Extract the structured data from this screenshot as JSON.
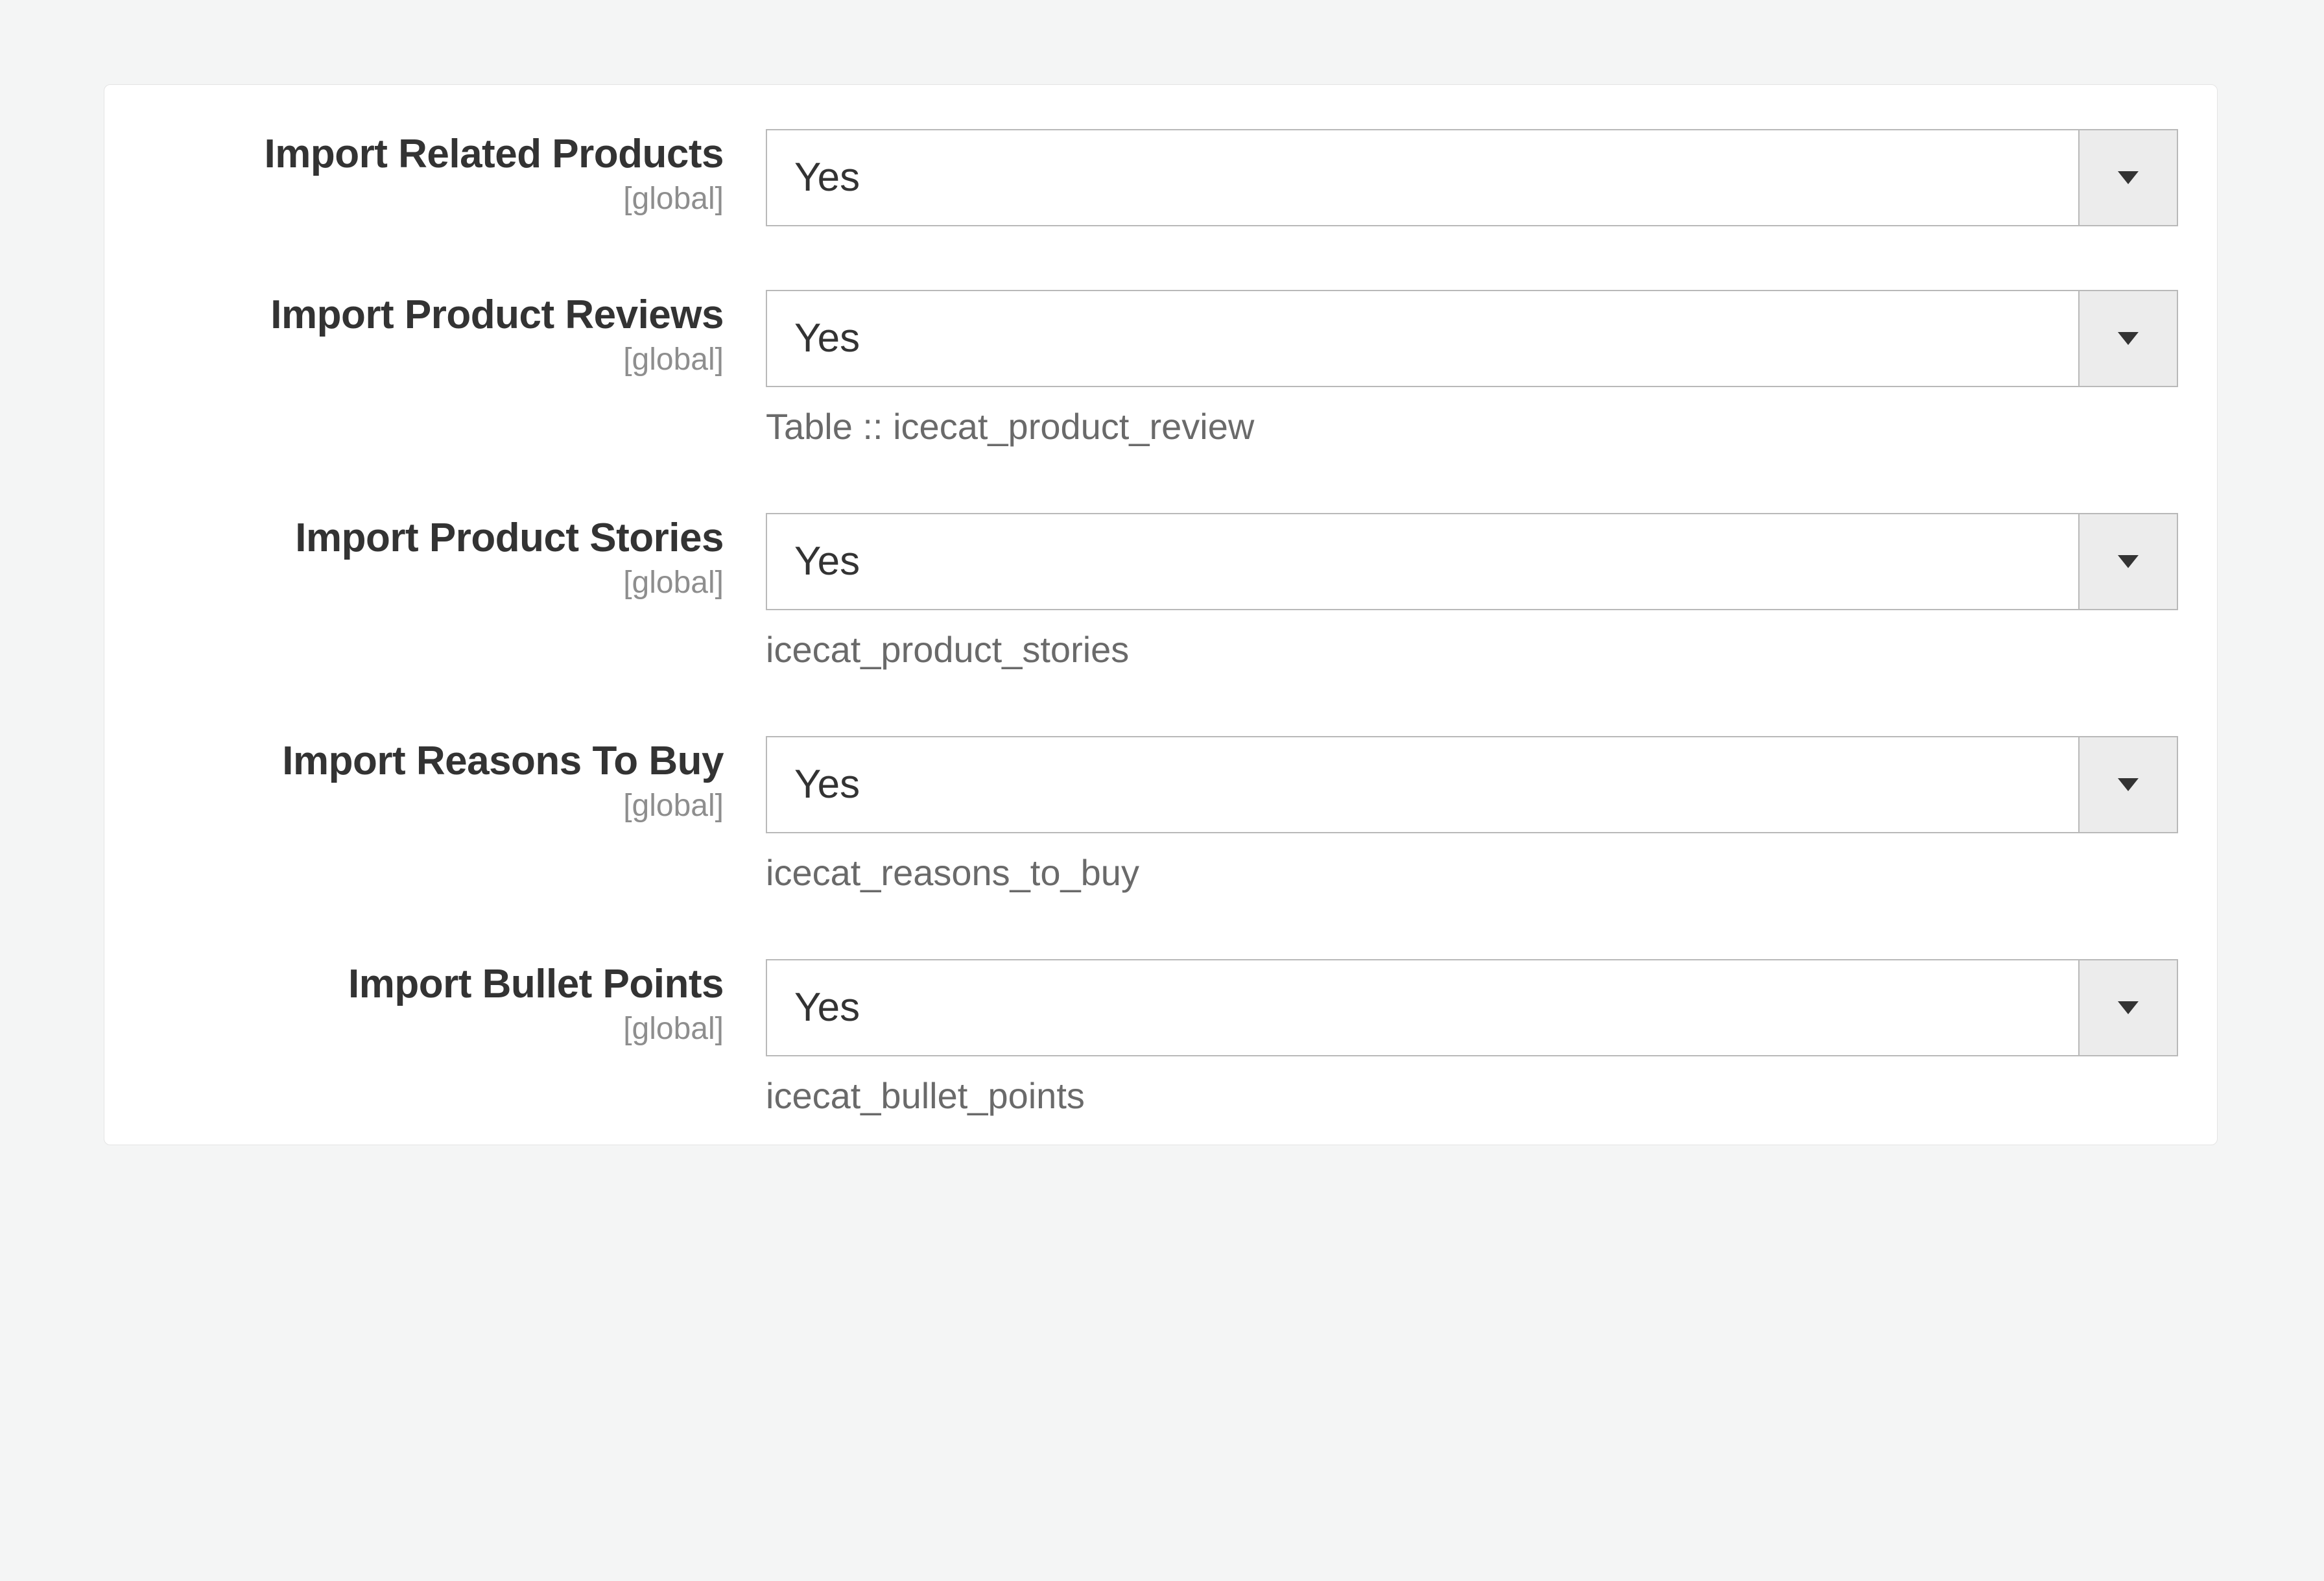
{
  "scope_label": "[global]",
  "fields": [
    {
      "label": "Import Related Products",
      "value": "Yes",
      "helper": ""
    },
    {
      "label": "Import Product Reviews",
      "value": "Yes",
      "helper": "Table :: icecat_product_review"
    },
    {
      "label": "Import Product Stories",
      "value": "Yes",
      "helper": "icecat_product_stories"
    },
    {
      "label": "Import Reasons To Buy",
      "value": "Yes",
      "helper": "icecat_reasons_to_buy"
    },
    {
      "label": "Import Bullet Points",
      "value": "Yes",
      "helper": "icecat_bullet_points"
    }
  ]
}
